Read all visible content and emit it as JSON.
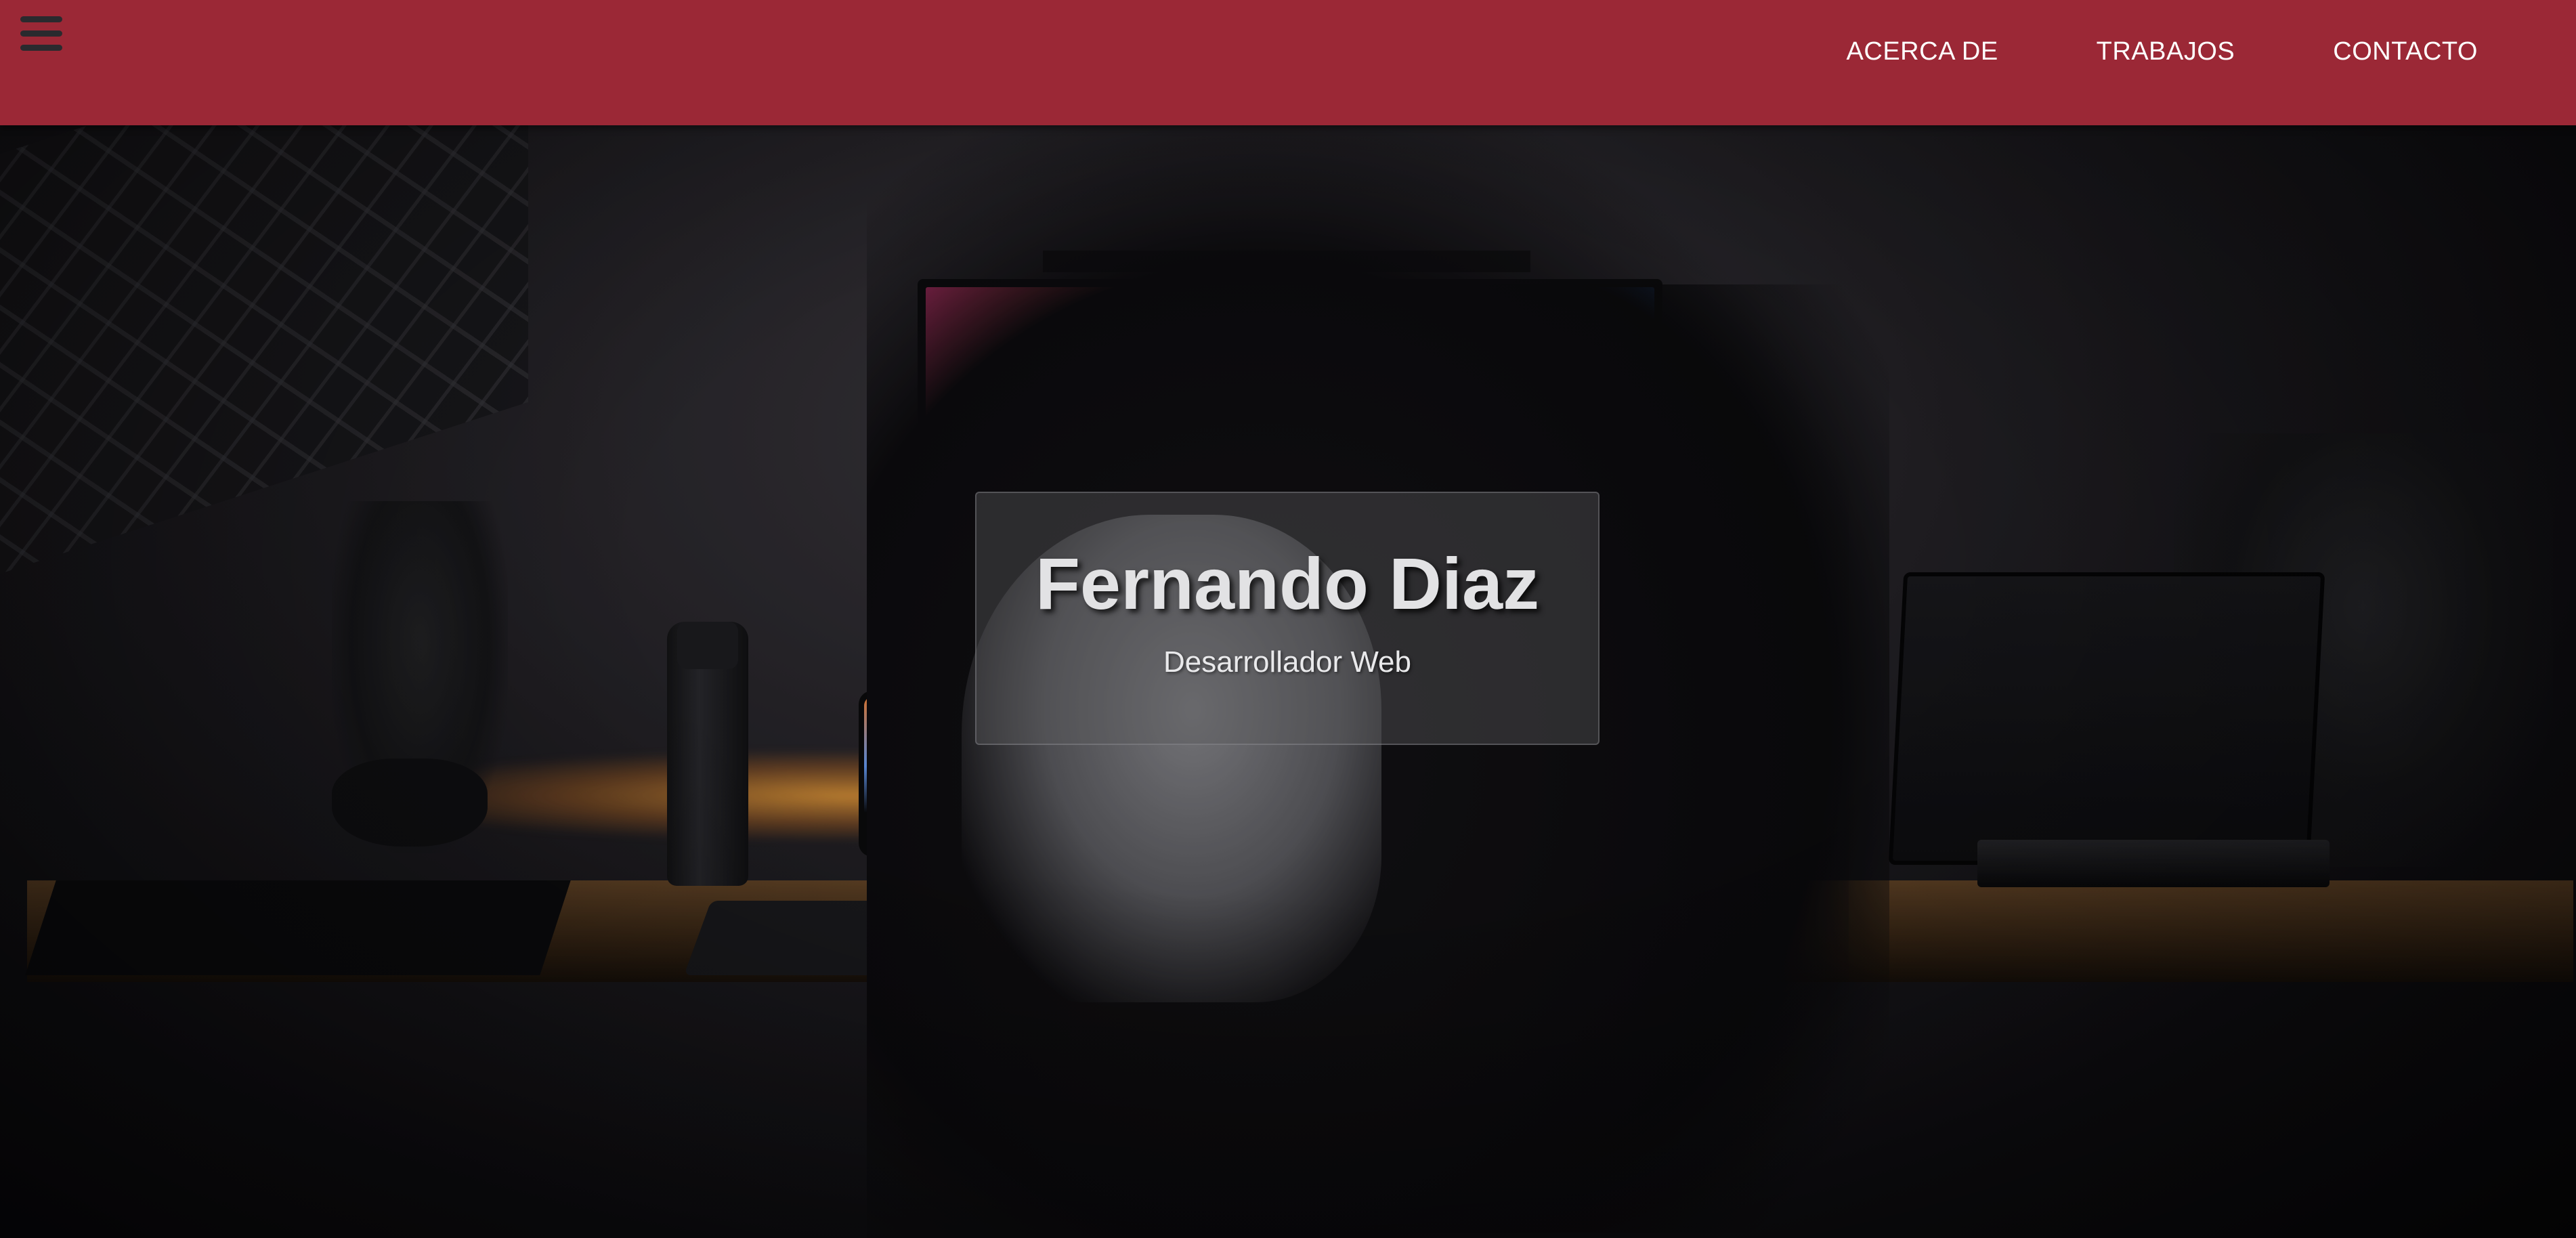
{
  "navbar": {
    "menu_icon": "hamburger-menu-icon",
    "background_color": "#9b2836",
    "links": [
      {
        "label": "ACERCA DE"
      },
      {
        "label": "TRABAJOS"
      },
      {
        "label": "CONTACTO"
      }
    ]
  },
  "hero": {
    "name": "Fernando Diaz",
    "subtitle": "Desarrollador Web",
    "phone_icon": "lightning-bolt-icon"
  }
}
